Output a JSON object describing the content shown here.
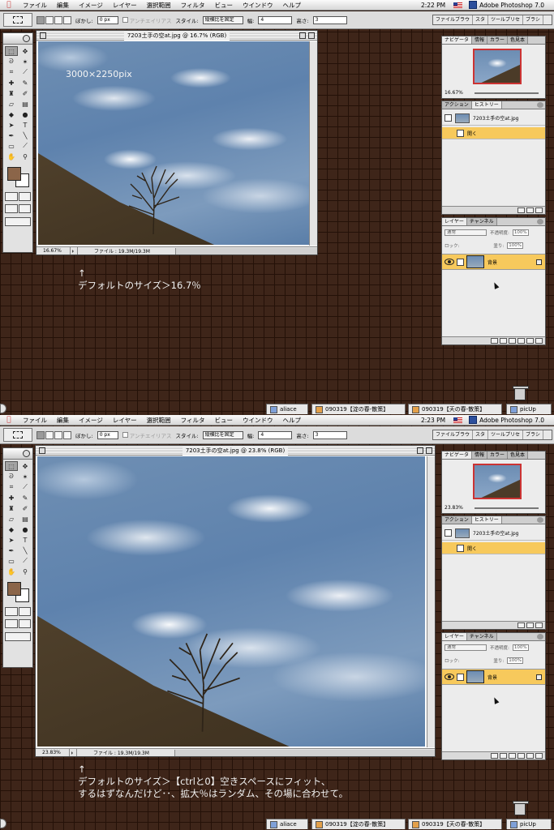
{
  "menubar": {
    "items": [
      "ファイル",
      "編集",
      "イメージ",
      "レイヤー",
      "選択範囲",
      "フィルタ",
      "ビュー",
      "ウインドウ",
      "ヘルプ"
    ],
    "app_name": "Adobe Photoshop 7.0"
  },
  "options_bar": {
    "feather_label": "ぼかし:",
    "feather_value": "0 px",
    "antialias_label": "アンチエイリアス",
    "style_label": "スタイル:",
    "style_value": "縦横比を固定",
    "width_label": "幅:",
    "width_value": "4",
    "height_label": "高さ:",
    "height_value": "3"
  },
  "palette_well": {
    "tabs": [
      "ファイルブラウ",
      "スタ",
      "ツールプリセ",
      "ブラシ"
    ]
  },
  "navigator": {
    "tabs": [
      "ナビゲータ",
      "情報",
      "カラー",
      "色見本"
    ]
  },
  "history": {
    "tabs": [
      "アクション",
      "ヒストリー"
    ],
    "snapshot": "7203土手の空at.jpg",
    "step": "開く"
  },
  "layers": {
    "tabs": [
      "レイヤー",
      "チャンネル"
    ],
    "blend_mode": "通常",
    "opacity_label": "不透明度:",
    "opacity": "100%",
    "lock_label": "ロック:",
    "fill_label": "塗り:",
    "fill": "100%",
    "layer_name": "背景"
  },
  "taskbar": {
    "items": [
      "aliace",
      "090319【淀の春-散策】",
      "090319【天の春-散策】",
      "picUp"
    ]
  },
  "screens": [
    {
      "clock": "2:22 PM",
      "doc_title": "7203土手の空at.jpg @ 16.7% (RGB)",
      "zoom": "16.67%",
      "file_info": "ファイル : 19.3M/19.3M",
      "nav_zoom": "16.67%",
      "image_label": "3000×2250pix",
      "caption_line1": "↑",
      "caption_line2": "デフォルトのサイズ＞16.7％"
    },
    {
      "clock": "2:23 PM",
      "doc_title": "7203土手の空at.jpg @ 23.8% (RGB)",
      "zoom": "23.83%",
      "file_info": "ファイル : 19.3M/19.3M",
      "nav_zoom": "23.83%",
      "caption_line1": "↑",
      "caption_line2": "デフォルトのサイズ＞【ctrlと0】空きスペースにフィット、",
      "caption_line3": "するはずなんだけど･･、拡大％はランダム、その場に合わせて。"
    }
  ]
}
